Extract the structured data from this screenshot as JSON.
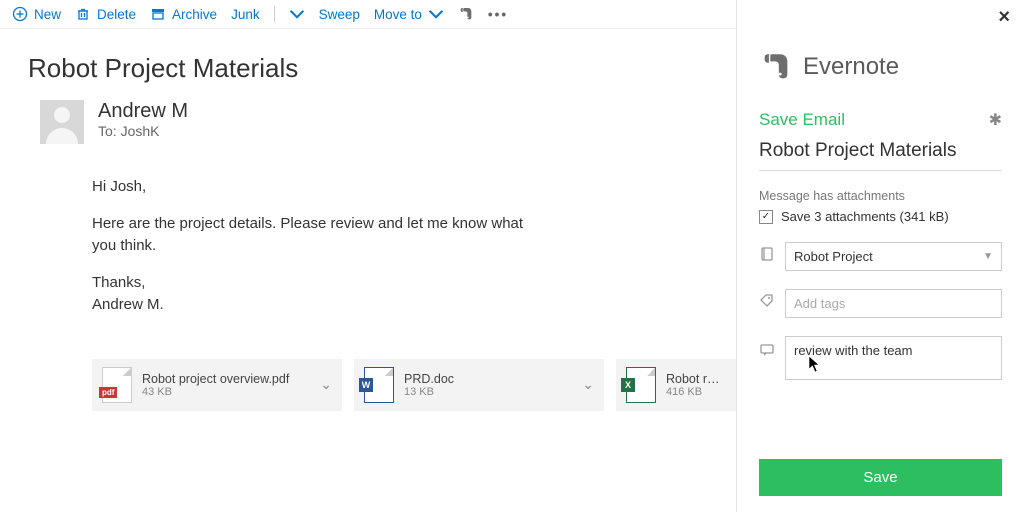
{
  "toolbar": {
    "new": "New",
    "delete": "Delete",
    "archive": "Archive",
    "junk": "Junk",
    "sweep": "Sweep",
    "move_to": "Move to"
  },
  "email": {
    "subject": "Robot Project Materials",
    "sender_name": "Andrew M",
    "to_prefix": "To: ",
    "to_name": "JoshK",
    "body_greeting": "Hi Josh,",
    "body_main": "Here are the project details. Please review and let me know what you think.",
    "body_thanks": "Thanks,",
    "body_signoff": "Andrew M."
  },
  "attachments": [
    {
      "name": "Robot project overview.pdf",
      "size": "43 KB",
      "type": "pdf",
      "badge": "pdf"
    },
    {
      "name": "PRD.doc",
      "size": "13 KB",
      "type": "doc",
      "badge": "W"
    },
    {
      "name": "Robot reve",
      "size": "416 KB",
      "type": "xls",
      "badge": "X"
    }
  ],
  "panel": {
    "brand": "Evernote",
    "save_email_label": "Save Email",
    "subject": "Robot Project Materials",
    "attach_note": "Message has attachments",
    "save_attachments_label": "Save 3 attachments (341 kB)",
    "notebook_value": "Robot Project",
    "tags_placeholder": "Add tags",
    "remark_value": "review with the team",
    "save_button": "Save"
  }
}
